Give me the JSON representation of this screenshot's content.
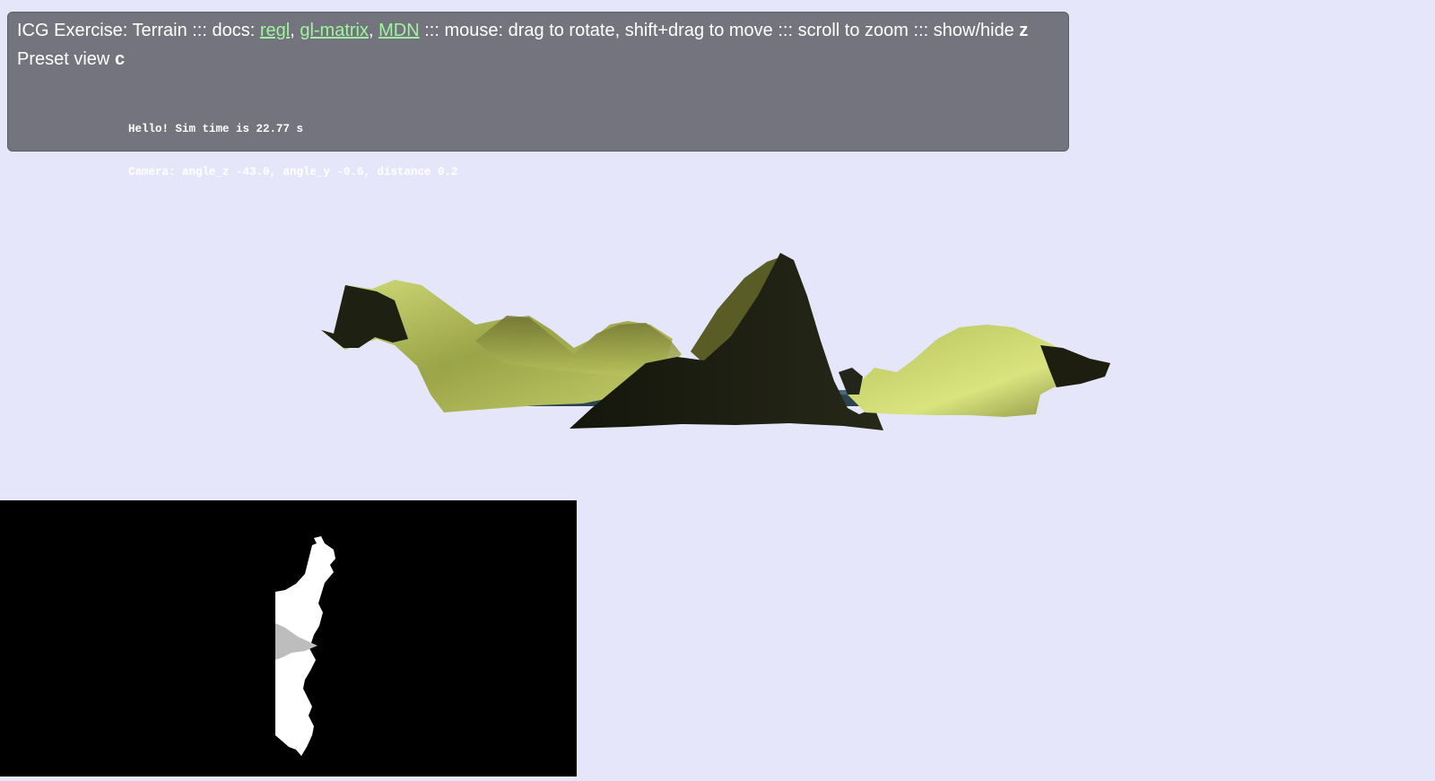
{
  "header": {
    "title": "ICG Exercise: Terrain",
    "sep": " ::: ",
    "docs_label": "docs: ",
    "links": [
      "regl",
      "gl-matrix",
      "MDN"
    ],
    "comma": ", ",
    "mouse_text": "mouse: drag to rotate, shift+drag to move",
    "zoom_text": "scroll to zoom",
    "showhide_label": "show/hide ",
    "showhide_key": "z",
    "preset_label": "Preset view ",
    "preset_key": "c"
  },
  "debug": {
    "line1": "Hello! Sim time is 22.77 s",
    "line2": "Camera: angle_z -43.0, angle_y -0.6, distance 0.2"
  },
  "colors": {
    "background": "#e6e6fa",
    "panel": "#74747f",
    "link": "#9ef59e",
    "terrain_light": "#c8d46a",
    "terrain_dark": "#1b1c10",
    "water": "#3a5566"
  },
  "icons": {
    "separator": "dotted-separator-icon"
  }
}
